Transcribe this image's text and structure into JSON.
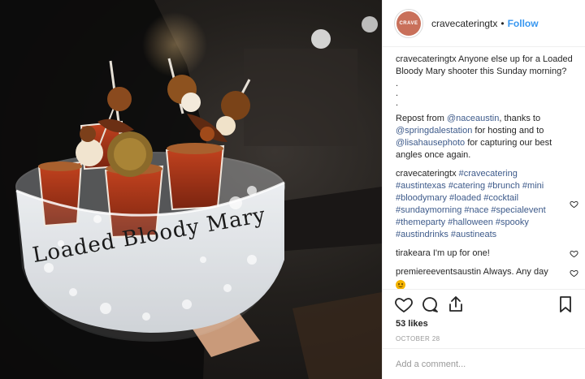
{
  "photo": {
    "glass_lettering": "Loaded Bloody Mary"
  },
  "header": {
    "username": "cravecateringtx",
    "separator": "•",
    "follow_label": "Follow",
    "avatar_text": "CRAVE"
  },
  "caption": {
    "username": "cravecateringtx",
    "text": "Anyone else up for a Loaded Bloody Mary shooter this Sunday morning?",
    "dots": [
      ".",
      ".",
      "."
    ],
    "repost_prefix": "Repost from ",
    "mention_1": "@naceaustin",
    "repost_mid_1": ", thanks to ",
    "mention_2": "@springdalestation",
    "repost_mid_2": " for hosting and to ",
    "mention_3": "@lisahausephoto",
    "repost_end": " for capturing our best angles once again."
  },
  "hashtag_comment": {
    "username": "cravecateringtx",
    "tags": "#cravecatering #austintexas #catering #brunch #mini #bloodymary #loaded #cocktail #sundaymorning #nace #specialevent #themeparty #halloween #spooky #austindrinks #austineats"
  },
  "comments": [
    {
      "username": "tirakeara",
      "text": "I'm up for one!"
    },
    {
      "username": "premiereeventsaustin",
      "text": "Always. Any day"
    }
  ],
  "engagement": {
    "likes": "53 likes",
    "date": "OCTOBER 28"
  },
  "add_comment": {
    "placeholder": "Add a comment..."
  },
  "icons": [
    "heart-icon",
    "comment-icon",
    "share-icon",
    "bookmark-icon"
  ]
}
